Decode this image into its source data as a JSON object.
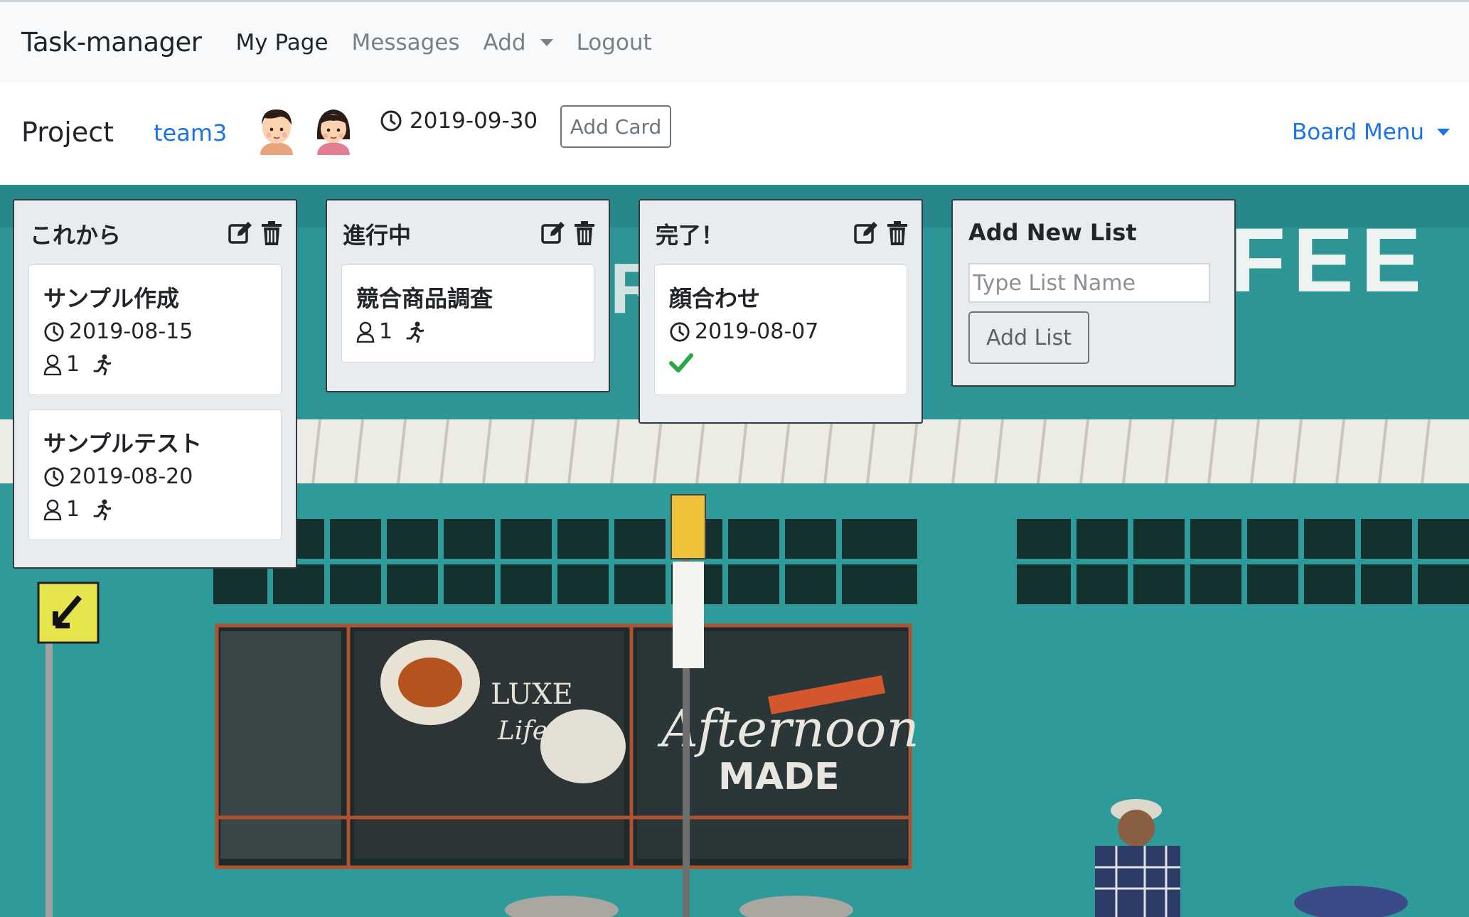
{
  "navbar": {
    "brand": "Task-manager",
    "items": [
      {
        "label": "My Page"
      },
      {
        "label": "Messages"
      },
      {
        "label": "Add"
      },
      {
        "label": "Logout"
      }
    ]
  },
  "board": {
    "project_label": "Project",
    "team": "team3",
    "due_date": "2019-09-30",
    "add_card_label": "Add Card",
    "menu_label": "Board Menu"
  },
  "lists": [
    {
      "name": "これから",
      "cards": [
        {
          "title": "サンプル作成",
          "date": "2019-08-15",
          "members": "1"
        },
        {
          "title": "サンプルテスト",
          "date": "2019-08-20",
          "members": "1"
        }
      ]
    },
    {
      "name": "進行中",
      "cards": [
        {
          "title": "競合商品調査",
          "members": "1"
        }
      ]
    },
    {
      "name": "完了！",
      "cards": [
        {
          "title": "顔合わせ",
          "date": "2019-08-07",
          "done": true
        }
      ]
    }
  ],
  "add_list": {
    "title": "Add New List",
    "placeholder": "Type List Name",
    "button_label": "Add List"
  },
  "colors": {
    "link": "#1a73e8",
    "wall": "#2f9a9a",
    "check": "#28a745"
  }
}
